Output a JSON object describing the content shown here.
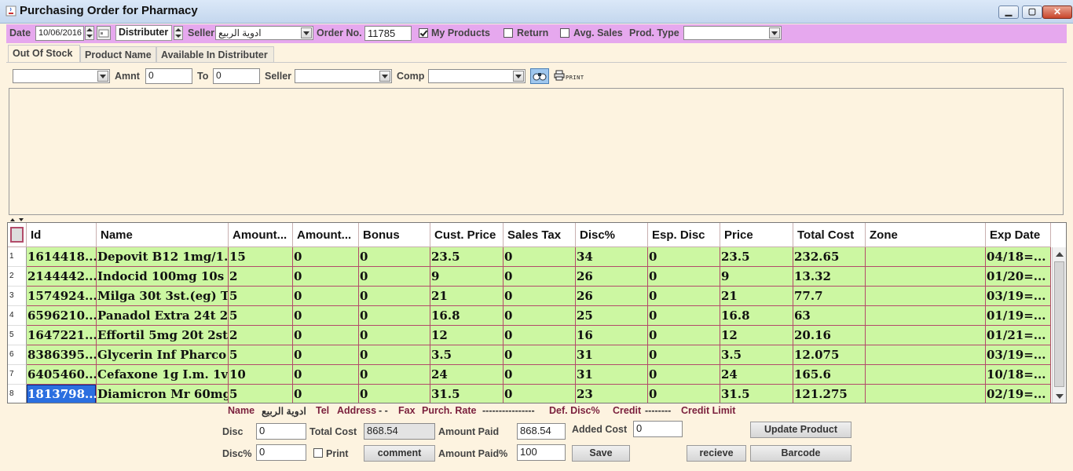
{
  "window": {
    "title": "Purchasing Order for Pharmacy",
    "min_symbol": "▁",
    "max_symbol": "▢",
    "close_symbol": "✕"
  },
  "toolbar": {
    "date_label": "Date",
    "date_value": "10/06/2016",
    "distributer_label": "Distributer",
    "seller_label": "Seller",
    "seller_value": "ادوية الربيع",
    "order_no_label": "Order No.",
    "order_no_value": "11785",
    "my_products_label": "My Products",
    "my_products_checked": true,
    "return_label": "Return",
    "avg_sales_label": "Avg. Sales",
    "prod_type_label": "Prod. Type",
    "prod_type_value": ""
  },
  "tabs": [
    "Out Of Stock",
    "Product Name",
    "Available In Distributer"
  ],
  "filter": {
    "combo1_value": "",
    "amnt_label": "Amnt",
    "amnt_value": "0",
    "to_label": "To",
    "to_value": "0",
    "seller_label": "Seller",
    "seller_value": "",
    "comp_label": "Comp",
    "comp_value": "",
    "print_label": "PRINT"
  },
  "grid": {
    "columns": [
      "Id",
      "Name",
      "Amount...",
      "Amount...",
      "Bonus",
      "Cust. Price",
      "Sales Tax",
      "Disc%",
      "Esp. Disc",
      "Price",
      "Total Cost",
      "Zone",
      "Exp Date"
    ],
    "rows": [
      [
        "1",
        "1614418...",
        "Depovit B12 1mg/1...",
        "15",
        "0",
        "0",
        "23.5",
        "0",
        "34",
        "0",
        "23.5",
        "232.65",
        "",
        "04/18=..."
      ],
      [
        "2",
        "2144442...",
        "Indocid 100mg 10s ...",
        "2",
        "0",
        "0",
        "9",
        "0",
        "26",
        "0",
        "9",
        "13.32",
        "",
        "01/20=..."
      ],
      [
        "3",
        "1574924...",
        "Milga 30t 3st.(eg) T...",
        "5",
        "0",
        "0",
        "21",
        "0",
        "26",
        "0",
        "21",
        "77.7",
        "",
        "03/19=..."
      ],
      [
        "4",
        "6596210...",
        "Panadol Extra 24t 2...",
        "5",
        "0",
        "0",
        "16.8",
        "0",
        "25",
        "0",
        "16.8",
        "63",
        "",
        "01/19=..."
      ],
      [
        "5",
        "1647221...",
        "Effortil 5mg 20t 2st...",
        "2",
        "0",
        "0",
        "12",
        "0",
        "16",
        "0",
        "12",
        "20.16",
        "",
        "01/21=..."
      ],
      [
        "6",
        "8386395...",
        "Glycerin Inf Pharco ...",
        "5",
        "0",
        "0",
        "3.5",
        "0",
        "31",
        "0",
        "3.5",
        "12.075",
        "",
        "03/19=..."
      ],
      [
        "7",
        "6405460...",
        "Cefaxone 1g I.m. 1v...",
        "10",
        "0",
        "0",
        "24",
        "0",
        "31",
        "0",
        "24",
        "165.6",
        "",
        "10/18=..."
      ],
      [
        "8",
        "1813798...",
        "Diamicron Mr 60mg ...",
        "5",
        "0",
        "0",
        "31.5",
        "0",
        "23",
        "0",
        "31.5",
        "121.275",
        "",
        "02/19=..."
      ]
    ]
  },
  "info": {
    "name_label": "Name",
    "name_value": "ادوية الربيع",
    "tel_label": "Tel",
    "address_label": "Address",
    "address_value": "- -",
    "fax_label": "Fax",
    "purch_rate_label": "Purch. Rate",
    "purch_rate_value": "----------------",
    "def_disc_label": "Def. Disc%",
    "credit_label": "Credit",
    "credit_value": "--------",
    "credit_limit_label": "Credit Limit"
  },
  "footer": {
    "disc_label": "Disc",
    "disc_value": "0",
    "disc_pct_label": "Disc%",
    "disc_pct_value": "0",
    "total_cost_label": "Total Cost",
    "total_cost_value": "868.54",
    "print_label": "Print",
    "comment_label": "comment",
    "amount_paid_label": "Amount Paid",
    "amount_paid_value": "868.54",
    "amount_paid_pct_label": "Amount Paid%",
    "amount_paid_pct_value": "100",
    "save_label": "Save",
    "added_cost_label": "Added Cost",
    "added_cost_value": "0",
    "update_product_label": "Update Product",
    "recieve_label": "recieve",
    "barcode_label": "Barcode"
  }
}
